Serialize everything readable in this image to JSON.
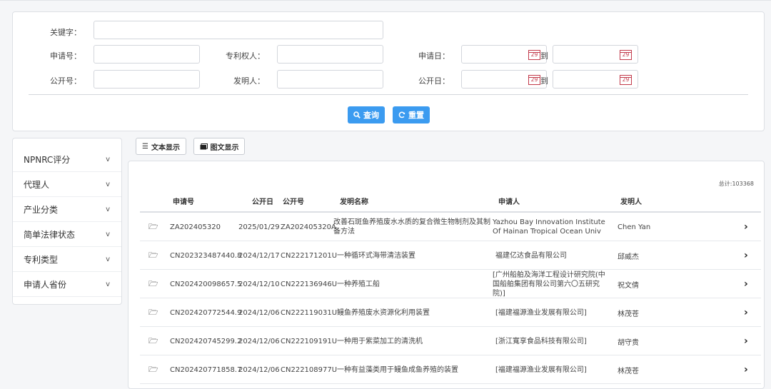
{
  "search": {
    "keyword_label": "关键字：",
    "app_no_label": "申请号：",
    "patentee_label": "专利权人：",
    "app_date_label": "申请日：",
    "pub_no_label": "公开号：",
    "inventor_label": "发明人：",
    "pub_date_label": "公开日：",
    "to_label": "到",
    "calendar_day": "29",
    "query_button": "查询",
    "reset_button": "重置"
  },
  "filters": [
    "NPNRC评分",
    "代理人",
    "产业分类",
    "简单法律状态",
    "专利类型",
    "申请人省份"
  ],
  "filter_chevron": "v",
  "view": {
    "text_view": "文本显示",
    "image_view": "图文显示"
  },
  "results": {
    "total": "总计:103368",
    "headers": {
      "app_no": "申请号",
      "pub_date": "公开日",
      "pub_no": "公开号",
      "title": "发明名称",
      "applicant": "申请人",
      "inventor": "发明人"
    },
    "rows": [
      {
        "app_no": "ZA202405320",
        "pub_date": "2025/01/29",
        "pub_no": "ZA202405320A",
        "title": "改善石斑鱼养殖废水水质的复合微生物制剂及其制备方法",
        "applicant": "Yazhou Bay Innovation Institute Of Hainan Tropical Ocean Univ",
        "inventor": "Chen Yan"
      },
      {
        "app_no": "CN202323487440.8",
        "pub_date": "2024/12/17",
        "pub_no": "CN222171201U",
        "title": "一种循环式海带清洁装置",
        "applicant": "福建亿达食品有限公司",
        "inventor": "邱威杰"
      },
      {
        "app_no": "CN202420098657.5",
        "pub_date": "2024/12/10",
        "pub_no": "CN222136946U",
        "title": "一种养殖工船",
        "applicant": "[广州船舶及海洋工程设计研究院(中国船舶集团有限公司第六〇五研究院)]",
        "inventor": "祝文倩"
      },
      {
        "app_no": "CN202420772544.9",
        "pub_date": "2024/12/06",
        "pub_no": "CN222119031U",
        "title": "鳗鱼养殖废水资源化利用装置",
        "applicant": "[福建福源渔业发展有限公司]",
        "inventor": "林茂苍"
      },
      {
        "app_no": "CN202420745299.2",
        "pub_date": "2024/12/06",
        "pub_no": "CN222109191U",
        "title": "一种用于紫菜加工的清洗机",
        "applicant": "[浙江寬享食品科技有限公司]",
        "inventor": "胡守贵"
      },
      {
        "app_no": "CN202420771858.7",
        "pub_date": "2024/12/06",
        "pub_no": "CN222108977U",
        "title": "一种有益藻类用于鳗鱼成鱼养殖的装置",
        "applicant": "[福建福源渔业发展有限公司]",
        "inventor": "林茂苍"
      }
    ]
  },
  "icons": {
    "search": "search-icon",
    "refresh": "refresh-icon",
    "list": "list-icon",
    "image": "image-icon",
    "folder": "folder-icon",
    "chevron_right": "chevron-right-icon"
  }
}
